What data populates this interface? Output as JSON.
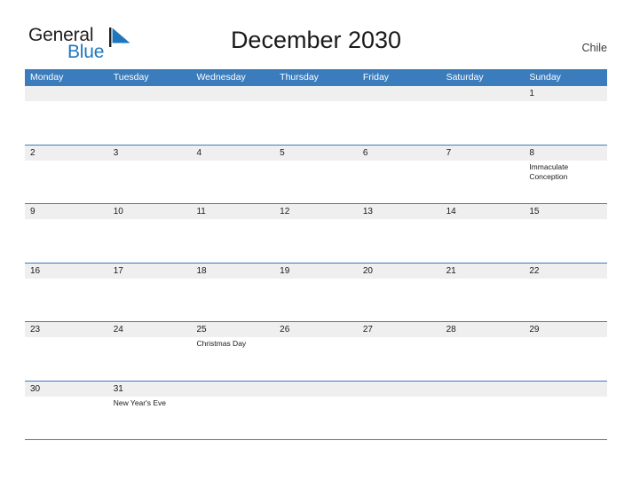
{
  "brand": {
    "name_part1": "General",
    "name_part2": "Blue",
    "flag_icon": "blue-triangle-flag-icon",
    "color_primary": "#1f76bd",
    "color_dark": "#231f20"
  },
  "header": {
    "title": "December 2030",
    "country": "Chile"
  },
  "theme": {
    "header_blue": "#3b7cbc",
    "row_divider": "#3b7cbc",
    "number_band_gray": "#efefef",
    "page_background": "#ffffff",
    "text_color": "#1a1a1a"
  },
  "calendar": {
    "month": "December",
    "year": "2030",
    "weekday_headers": [
      "Monday",
      "Tuesday",
      "Wednesday",
      "Thursday",
      "Friday",
      "Saturday",
      "Sunday"
    ],
    "weeks": [
      {
        "days": [
          {
            "number": "",
            "events": []
          },
          {
            "number": "",
            "events": []
          },
          {
            "number": "",
            "events": []
          },
          {
            "number": "",
            "events": []
          },
          {
            "number": "",
            "events": []
          },
          {
            "number": "",
            "events": []
          },
          {
            "number": "1",
            "events": []
          }
        ]
      },
      {
        "days": [
          {
            "number": "2",
            "events": []
          },
          {
            "number": "3",
            "events": []
          },
          {
            "number": "4",
            "events": []
          },
          {
            "number": "5",
            "events": []
          },
          {
            "number": "6",
            "events": []
          },
          {
            "number": "7",
            "events": []
          },
          {
            "number": "8",
            "events": [
              "Immaculate Conception"
            ]
          }
        ]
      },
      {
        "days": [
          {
            "number": "9",
            "events": []
          },
          {
            "number": "10",
            "events": []
          },
          {
            "number": "11",
            "events": []
          },
          {
            "number": "12",
            "events": []
          },
          {
            "number": "13",
            "events": []
          },
          {
            "number": "14",
            "events": []
          },
          {
            "number": "15",
            "events": []
          }
        ]
      },
      {
        "days": [
          {
            "number": "16",
            "events": []
          },
          {
            "number": "17",
            "events": []
          },
          {
            "number": "18",
            "events": []
          },
          {
            "number": "19",
            "events": []
          },
          {
            "number": "20",
            "events": []
          },
          {
            "number": "21",
            "events": []
          },
          {
            "number": "22",
            "events": []
          }
        ]
      },
      {
        "days": [
          {
            "number": "23",
            "events": []
          },
          {
            "number": "24",
            "events": []
          },
          {
            "number": "25",
            "events": [
              "Christmas Day"
            ]
          },
          {
            "number": "26",
            "events": []
          },
          {
            "number": "27",
            "events": []
          },
          {
            "number": "28",
            "events": []
          },
          {
            "number": "29",
            "events": []
          }
        ]
      },
      {
        "days": [
          {
            "number": "30",
            "events": []
          },
          {
            "number": "31",
            "events": [
              "New Year's Eve"
            ]
          },
          {
            "number": "",
            "events": []
          },
          {
            "number": "",
            "events": []
          },
          {
            "number": "",
            "events": []
          },
          {
            "number": "",
            "events": []
          },
          {
            "number": "",
            "events": []
          }
        ]
      }
    ]
  }
}
